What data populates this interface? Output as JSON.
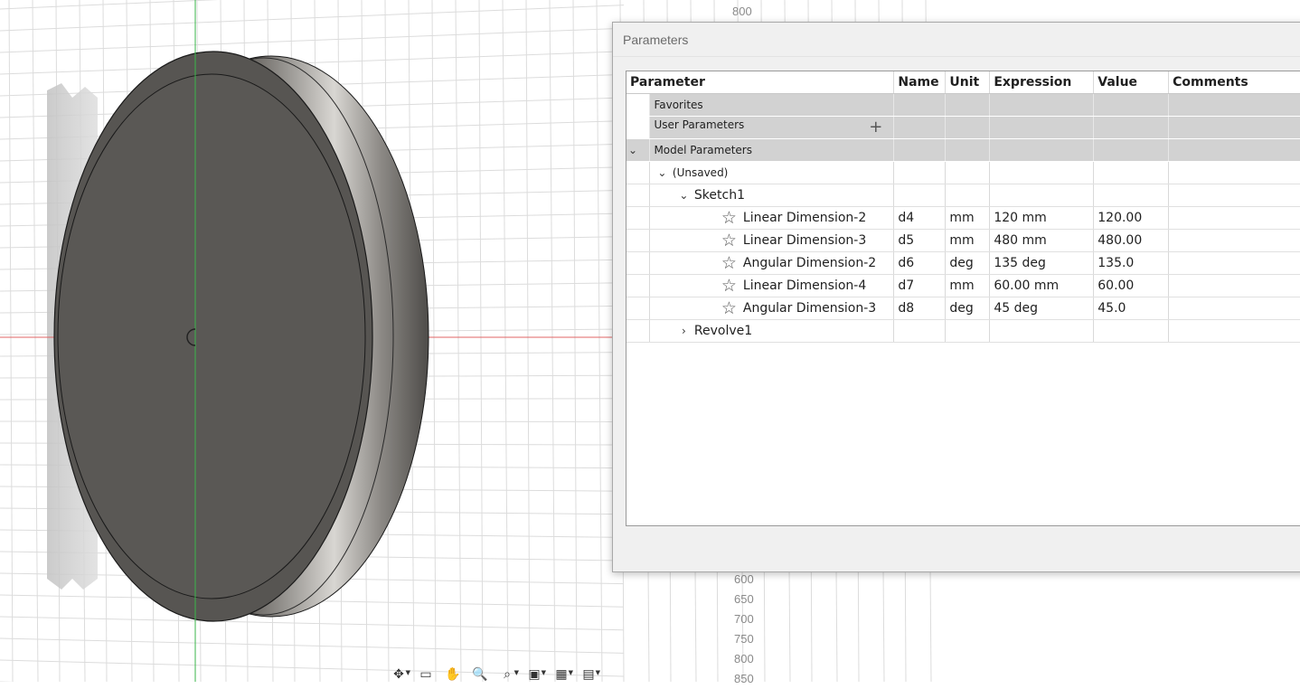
{
  "viewport": {
    "ruler_top_labels": [
      "800"
    ],
    "ruler_bottom_labels": [
      "600",
      "650",
      "700",
      "750",
      "800",
      "850"
    ],
    "toolbar": [
      {
        "icon": "orbit-icon",
        "glyph": "✥",
        "dropdown": true
      },
      {
        "icon": "look-at-icon",
        "glyph": "▭",
        "dropdown": false
      },
      {
        "icon": "pan-icon",
        "glyph": "✋",
        "dropdown": false
      },
      {
        "icon": "zoom-icon",
        "glyph": "🔍",
        "dropdown": false
      },
      {
        "icon": "fit-icon",
        "glyph": "⌕",
        "dropdown": true
      },
      {
        "icon": "display-settings-icon",
        "glyph": "▣",
        "dropdown": true
      },
      {
        "icon": "grid-settings-icon",
        "glyph": "▦",
        "dropdown": true
      },
      {
        "icon": "viewports-icon",
        "glyph": "▤",
        "dropdown": true
      }
    ],
    "colors": {
      "x_axis": "#e06666",
      "y_axis": "#3ab64a",
      "body": "#575552",
      "grid": "#dcdcdc"
    }
  },
  "dialog": {
    "title": "Parameters",
    "columns": [
      "Parameter",
      "Name",
      "Unit",
      "Expression",
      "Value",
      "Comments"
    ],
    "groups": {
      "favorites": "Favorites",
      "user": "User Parameters",
      "model": "Model Parameters",
      "unsaved": "(Unsaved)",
      "sketch": "Sketch1",
      "revolve": "Revolve1"
    },
    "rows": [
      {
        "parameter": "Linear Dimension-2",
        "name": "d4",
        "unit": "mm",
        "expression": "120 mm",
        "value": "120.00",
        "comments": ""
      },
      {
        "parameter": "Linear Dimension-3",
        "name": "d5",
        "unit": "mm",
        "expression": "480 mm",
        "value": "480.00",
        "comments": ""
      },
      {
        "parameter": "Angular Dimension-2",
        "name": "d6",
        "unit": "deg",
        "expression": "135 deg",
        "value": "135.0",
        "comments": ""
      },
      {
        "parameter": "Linear Dimension-4",
        "name": "d7",
        "unit": "mm",
        "expression": "60.00 mm",
        "value": "60.00",
        "comments": ""
      },
      {
        "parameter": "Angular Dimension-3",
        "name": "d8",
        "unit": "deg",
        "expression": "45 deg",
        "value": "45.0",
        "comments": ""
      }
    ]
  }
}
